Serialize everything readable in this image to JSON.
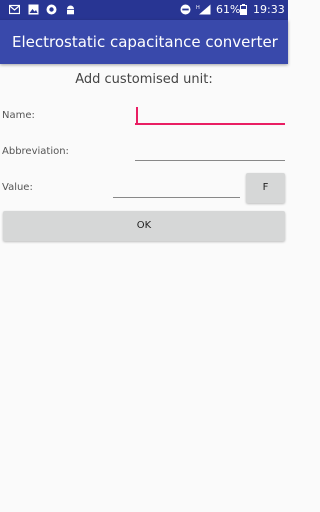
{
  "status_bar": {
    "battery": "61%",
    "time": "19:33"
  },
  "app_bar": {
    "title": "Electrostatic capacitance converter"
  },
  "form": {
    "heading": "Add customised unit:",
    "name_label": "Name:",
    "name_value": "",
    "abbreviation_label": "Abbreviation:",
    "abbreviation_value": "",
    "value_label": "Value:",
    "value_value": "",
    "unit_button": "F",
    "ok_button": "OK"
  },
  "colors": {
    "status_bar": "#283593",
    "app_bar": "#3949ab",
    "accent": "#e91e63",
    "button": "#d6d7d7",
    "background": "#fafafa"
  }
}
